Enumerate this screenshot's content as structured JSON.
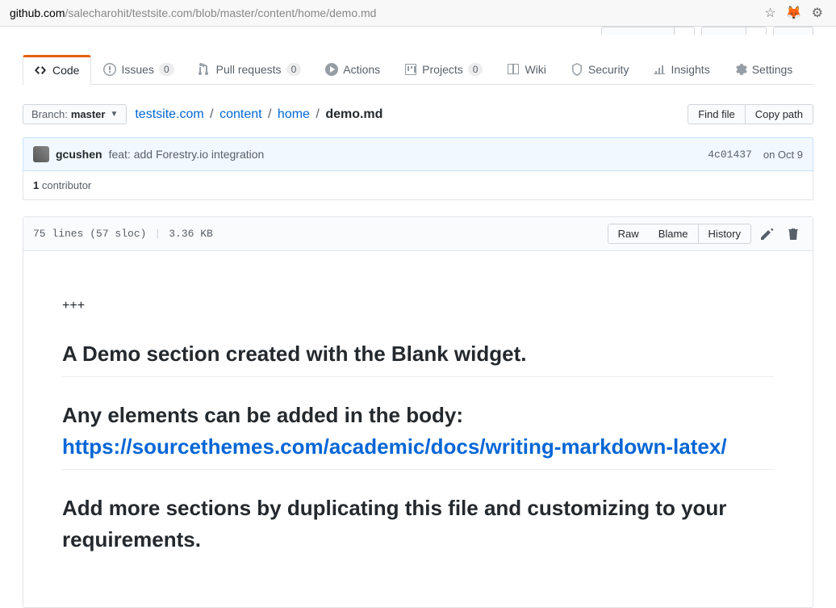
{
  "url": {
    "domain": "github.com",
    "path": "/salecharohit/testsite.com/blob/master/content/home/demo.md"
  },
  "nav": {
    "code": "Code",
    "issues": "Issues",
    "issues_count": "0",
    "pulls": "Pull requests",
    "pulls_count": "0",
    "actions": "Actions",
    "projects": "Projects",
    "projects_count": "0",
    "wiki": "Wiki",
    "security": "Security",
    "insights": "Insights",
    "settings": "Settings"
  },
  "branch": {
    "label": "Branch:",
    "name": "master"
  },
  "breadcrumbs": {
    "repo": "testsite.com",
    "p1": "content",
    "p2": "home",
    "file": "demo.md"
  },
  "buttons": {
    "find_file": "Find file",
    "copy_path": "Copy path",
    "raw": "Raw",
    "blame": "Blame",
    "history": "History"
  },
  "commit": {
    "author": "gcushen",
    "message": "feat: add Forestry.io integration",
    "sha": "4c01437",
    "date": "on Oct 9"
  },
  "contrib": {
    "count": "1",
    "label": " contributor"
  },
  "file": {
    "lines": "75 lines (57 sloc)",
    "size": "3.36 KB"
  },
  "content": {
    "frontmatter": "+++",
    "h1": "A Demo section created with the Blank widget.",
    "h2_text": "Any elements can be added in the body: ",
    "h2_link": "https://sourcethemes.com/academic/docs/writing-markdown-latex/",
    "h3": "Add more sections by duplicating this file and customizing to your requirements."
  }
}
